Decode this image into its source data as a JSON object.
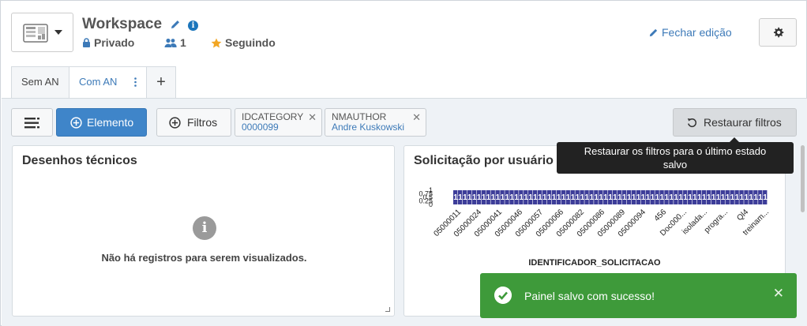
{
  "header": {
    "title": "Workspace",
    "privacy": "Privado",
    "members": "1",
    "following": "Seguindo",
    "close_edit": "Fechar edição"
  },
  "tabs": [
    {
      "label": "Sem AN"
    },
    {
      "label": "Com AN"
    }
  ],
  "tab_add": "+",
  "toolbar": {
    "element": "Elemento",
    "filters": "Filtros",
    "restore": "Restaurar filtros"
  },
  "filters": [
    {
      "key": "IDCATEGORY",
      "value": "0000099"
    },
    {
      "key": "NMAUTHOR",
      "value": "Andre Kuskowski"
    }
  ],
  "panels": {
    "left": {
      "title": "Desenhos técnicos",
      "empty": "Não há registros para serem visualizados."
    },
    "right": {
      "title": "Solicitação por usuário"
    }
  },
  "tooltip": {
    "line1": "Restaurar os filtros para o último estado",
    "line2": "salvo"
  },
  "toast": {
    "message": "Painel salvo com sucesso!"
  },
  "colors": {
    "accent": "#3f85c9",
    "success": "#3e9a3a",
    "bar": "#3d3d99"
  },
  "chart_data": {
    "type": "bar",
    "xlabel": "IDENTIFICADOR_SOLICITACAO",
    "ylabel": "",
    "yticks": [
      "1",
      "0.75",
      "0.5",
      "0.25",
      "0"
    ],
    "ylim": [
      0,
      1
    ],
    "visible_tick_labels": [
      "05000011",
      "05000024",
      "05000041",
      "05000046",
      "05000057",
      "05000066",
      "05000082",
      "05000086",
      "05000089",
      "05000094",
      "456",
      "Doc000...",
      "isolada...",
      "progra...",
      "Ql4",
      "treinam..."
    ],
    "values": [
      1,
      1,
      1,
      1,
      1,
      1,
      1,
      1,
      1,
      1,
      1,
      1,
      1,
      1,
      1,
      1,
      1,
      1,
      1,
      1,
      1,
      1,
      1,
      1,
      1,
      1,
      1,
      1,
      1,
      1,
      1,
      1,
      1,
      1,
      1,
      1,
      1,
      1,
      1,
      1,
      1,
      1,
      1,
      1,
      1,
      1,
      1,
      1,
      1,
      1,
      1,
      1,
      1,
      1,
      1,
      1,
      1,
      1,
      1,
      1,
      1,
      1,
      1,
      1,
      1,
      1,
      1
    ],
    "data_label": "1"
  }
}
